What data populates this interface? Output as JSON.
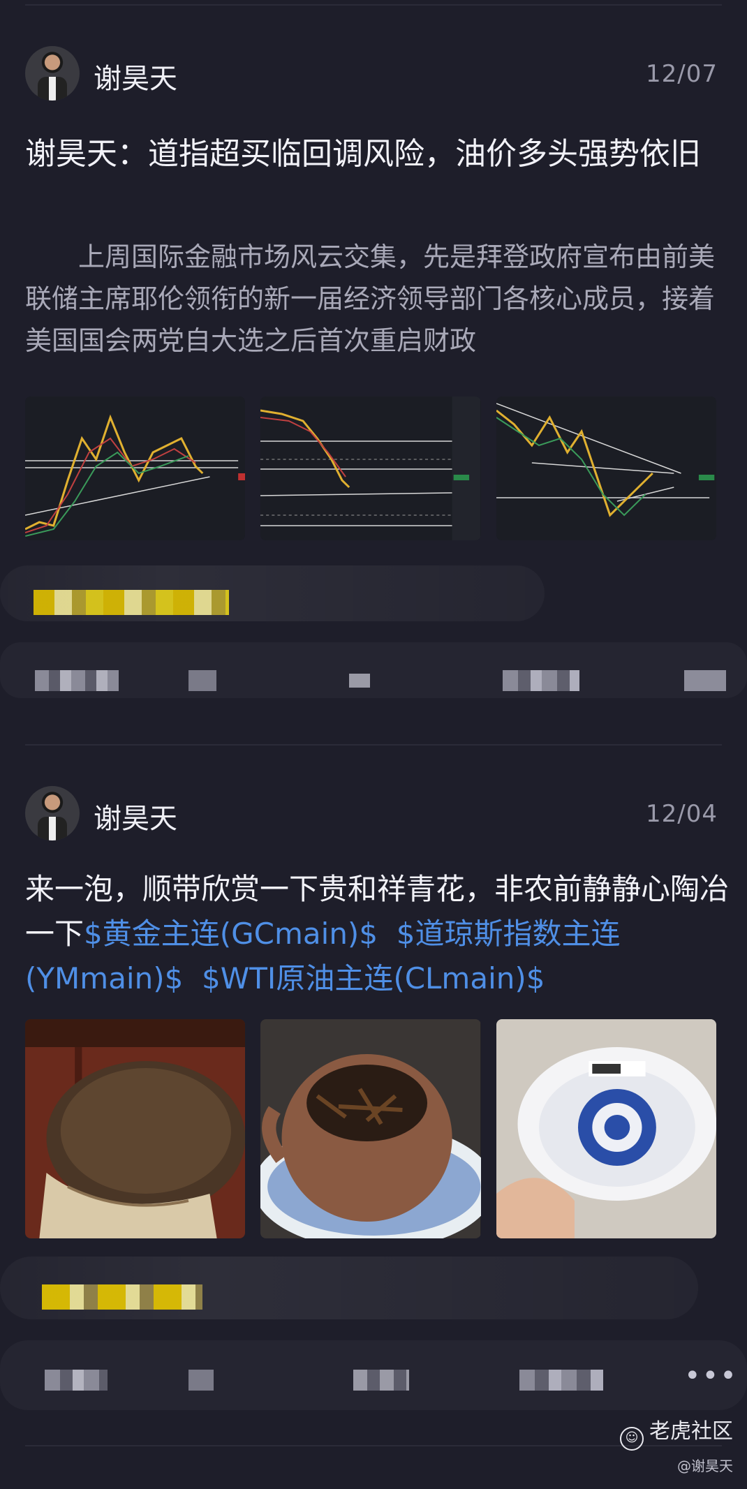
{
  "posts": [
    {
      "author": "谢昊天",
      "date": "12/07",
      "title": "谢昊天：道指超买临回调风险，油价多头强势依旧",
      "body": "上周国际金融市场风云交集，先是拜登政府宣布由前美联储主席耶伦领衔的新一届经济领导部门各核心成员，接着美国国会两党自大选之后首次重启财政"
    },
    {
      "author": "谢昊天",
      "date": "12/04",
      "text": "来一泡，顺带欣赏一下贵和祥青花，非农前静静心陶冶一下",
      "tags": [
        "$黄金主连(GCmain)$",
        "$道琼斯指数主连(YMmain)$",
        "$WTI原油主连(CLmain)$"
      ]
    }
  ],
  "more_label": "•••",
  "watermark": {
    "brand": "老虎社区",
    "handle": "@谢昊天"
  }
}
